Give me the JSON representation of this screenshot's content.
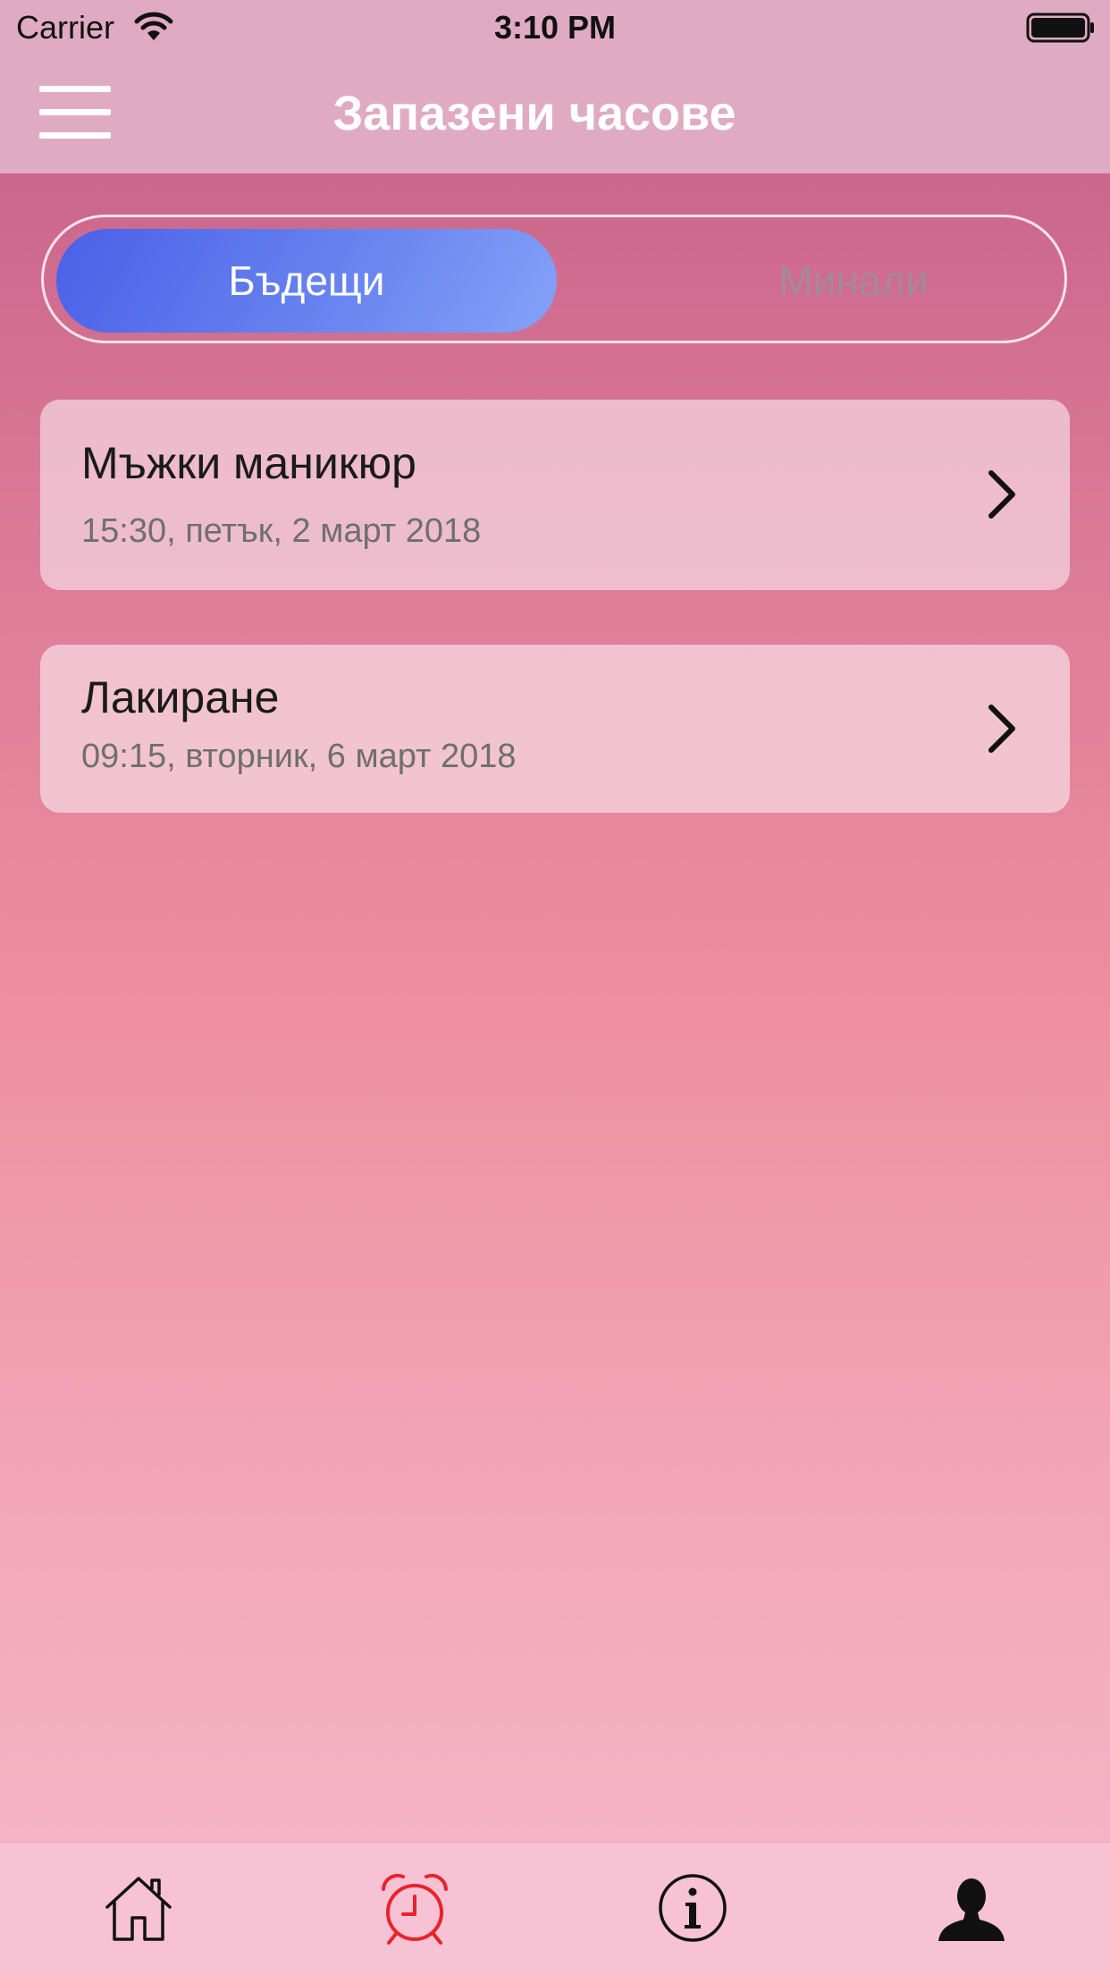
{
  "status_bar": {
    "carrier": "Carrier",
    "time": "3:10 PM",
    "icons": [
      "wifi-icon",
      "battery-icon"
    ]
  },
  "nav_bar": {
    "title": "Запазени часове",
    "menu_icon": "hamburger-menu-icon"
  },
  "segments": {
    "selected": "future",
    "items": [
      {
        "id": "future",
        "label": "Бъдещи"
      },
      {
        "id": "past",
        "label": "Минали"
      }
    ]
  },
  "appointments": [
    {
      "title": "Мъжки маникюр",
      "datetime": "15:30, петък, 2 март 2018",
      "icon": "chevron-right-icon"
    },
    {
      "title": "Лакиране",
      "datetime": "09:15, вторник, 6 март 2018",
      "icon": "chevron-right-icon"
    }
  ],
  "tab_bar": {
    "selected": "appointments",
    "tabs": [
      {
        "id": "home",
        "icon": "home-icon"
      },
      {
        "id": "appointments",
        "icon": "alarm-clock-icon"
      },
      {
        "id": "info",
        "icon": "info-icon"
      },
      {
        "id": "profile",
        "icon": "profile-icon"
      }
    ]
  },
  "colors": {
    "accent": "#4a60e8",
    "active_tab_icon": "#e8232a",
    "header": "#e0abc2",
    "tab_bar": "#f6c2d4"
  }
}
